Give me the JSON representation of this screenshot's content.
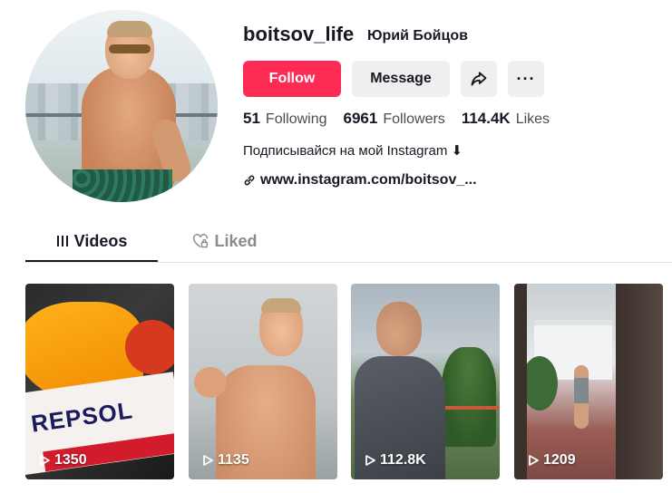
{
  "profile": {
    "username": "boitsov_life",
    "nickname": "Юрий Бойцов",
    "bio": "Подписывайся на мой Instagram ⬇",
    "link": "www.instagram.com/boitsov_..."
  },
  "actions": {
    "follow_label": "Follow",
    "message_label": "Message",
    "share_icon": "share-arrow-icon",
    "more_icon": "more-dots-icon",
    "more_glyph": "···"
  },
  "stats": {
    "following_count": "51",
    "following_label": "Following",
    "followers_count": "6961",
    "followers_label": "Followers",
    "likes_count": "114.4K",
    "likes_label": "Likes"
  },
  "tabs": [
    {
      "label": "Videos",
      "active": true,
      "icon": "grid-lines-icon"
    },
    {
      "label": "Liked",
      "active": false,
      "icon": "heart-lock-icon"
    }
  ],
  "videos": [
    {
      "views": "1350"
    },
    {
      "views": "1135"
    },
    {
      "views": "112.8K"
    },
    {
      "views": "1209"
    }
  ],
  "thumbnail_text": {
    "repsol": "REPSOL"
  },
  "colors": {
    "accent": "#fe2c55",
    "text": "#161823",
    "button_secondary": "#efeff0"
  }
}
